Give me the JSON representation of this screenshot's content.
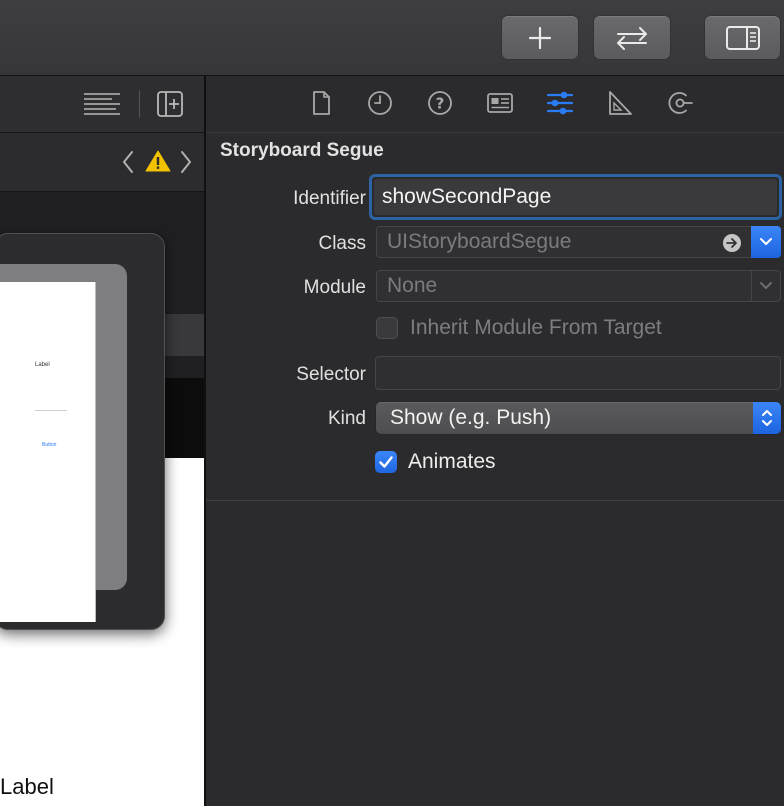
{
  "toolbar": {
    "buttons": [
      {
        "name": "add-library-button",
        "icon": "plus-icon"
      },
      {
        "name": "code-review-button",
        "icon": "arrows-exchange-icon"
      },
      {
        "name": "toggle-inspector-button",
        "icon": "sidebar-right-icon"
      }
    ]
  },
  "editor": {
    "options_icon": "editor-options-icon",
    "add_editor_icon": "add-editor-icon",
    "navigation": {
      "back": "chevron-left-icon",
      "warning": "warning-icon",
      "forward": "chevron-right-icon"
    },
    "canvas": {
      "scene_preview_title": "Label",
      "scene_preview_button": "Button",
      "bottom_label": "Label"
    }
  },
  "inspector": {
    "tabs": [
      {
        "name": "file-inspector-tab",
        "icon": "document-icon",
        "selected": false
      },
      {
        "name": "history-inspector-tab",
        "icon": "clock-icon",
        "selected": false
      },
      {
        "name": "quick-help-tab",
        "icon": "question-icon",
        "selected": false
      },
      {
        "name": "identity-inspector-tab",
        "icon": "identity-card-icon",
        "selected": false
      },
      {
        "name": "attributes-inspector-tab",
        "icon": "sliders-icon",
        "selected": true
      },
      {
        "name": "size-inspector-tab",
        "icon": "ruler-icon",
        "selected": false
      },
      {
        "name": "connections-inspector-tab",
        "icon": "connections-icon",
        "selected": false
      }
    ],
    "section_title": "Storyboard Segue",
    "identifier": {
      "label": "Identifier",
      "value": "showSecondPage"
    },
    "class": {
      "label": "Class",
      "placeholder": "UIStoryboardSegue"
    },
    "module": {
      "label": "Module",
      "placeholder": "None"
    },
    "inherit": {
      "label": "Inherit Module From Target",
      "checked": false
    },
    "selector": {
      "label": "Selector",
      "value": ""
    },
    "kind": {
      "label": "Kind",
      "value": "Show (e.g. Push)"
    },
    "animates": {
      "label": "Animates",
      "checked": true
    },
    "accent_color": "#2a7cf6"
  }
}
